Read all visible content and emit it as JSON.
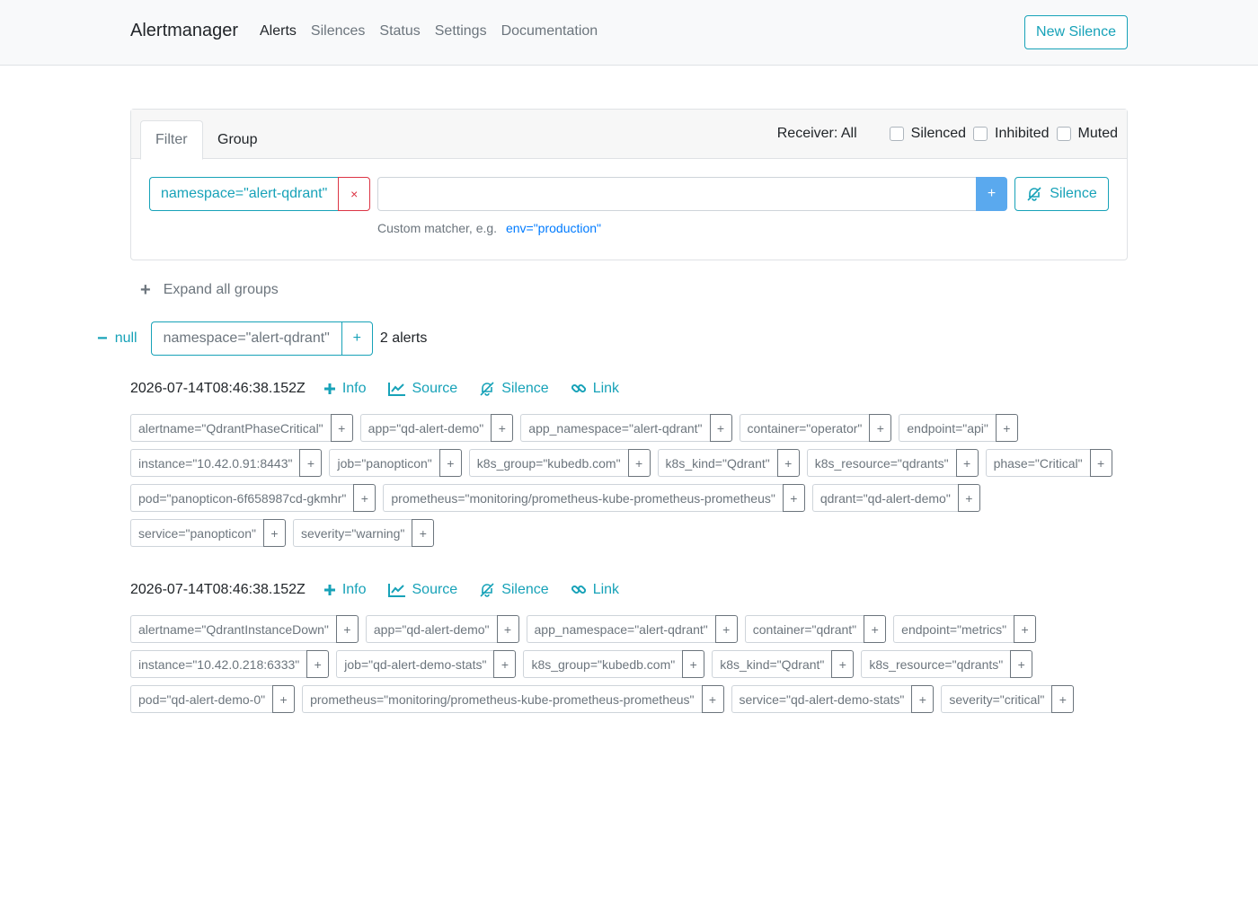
{
  "nav": {
    "brand": "Alertmanager",
    "links": [
      "Alerts",
      "Silences",
      "Status",
      "Settings",
      "Documentation"
    ],
    "new_silence": "New Silence"
  },
  "filter": {
    "tabs": [
      "Filter",
      "Group"
    ],
    "receiver": "Receiver: All",
    "checkboxes": [
      "Silenced",
      "Inhibited",
      "Muted"
    ],
    "matcher": "namespace=\"alert-qdrant\"",
    "remove": "×",
    "input_value": "",
    "add": "+",
    "silence": "Silence",
    "hint": "Custom matcher, e.g.",
    "hint_example": "env=\"production\""
  },
  "expand_all": "Expand all groups",
  "group": {
    "name": "null",
    "matcher": "namespace=\"alert-qdrant\"",
    "add": "+",
    "count": "2 alerts"
  },
  "actions": {
    "info": "Info",
    "source": "Source",
    "silence": "Silence",
    "link": "Link"
  },
  "alerts": [
    {
      "timestamp": "2026-07-14T08:46:38.152Z",
      "labels": [
        "alertname=\"QdrantPhaseCritical\"",
        "app=\"qd-alert-demo\"",
        "app_namespace=\"alert-qdrant\"",
        "container=\"operator\"",
        "endpoint=\"api\"",
        "instance=\"10.42.0.91:8443\"",
        "job=\"panopticon\"",
        "k8s_group=\"kubedb.com\"",
        "k8s_kind=\"Qdrant\"",
        "k8s_resource=\"qdrants\"",
        "phase=\"Critical\"",
        "pod=\"panopticon-6f658987cd-gkmhr\"",
        "prometheus=\"monitoring/prometheus-kube-prometheus-prometheus\"",
        "qdrant=\"qd-alert-demo\"",
        "service=\"panopticon\"",
        "severity=\"warning\""
      ]
    },
    {
      "timestamp": "2026-07-14T08:46:38.152Z",
      "labels": [
        "alertname=\"QdrantInstanceDown\"",
        "app=\"qd-alert-demo\"",
        "app_namespace=\"alert-qdrant\"",
        "container=\"qdrant\"",
        "endpoint=\"metrics\"",
        "instance=\"10.42.0.218:6333\"",
        "job=\"qd-alert-demo-stats\"",
        "k8s_group=\"kubedb.com\"",
        "k8s_kind=\"Qdrant\"",
        "k8s_resource=\"qdrants\"",
        "pod=\"qd-alert-demo-0\"",
        "prometheus=\"monitoring/prometheus-kube-prometheus-prometheus\"",
        "service=\"qd-alert-demo-stats\"",
        "severity=\"critical\""
      ]
    }
  ],
  "colors": {
    "accent": "#17a2b8",
    "danger": "#dc3545",
    "primary": "#5aa9ee"
  },
  "icons": {
    "info": "plus-icon",
    "source": "chart-line-icon",
    "silence": "bell-slash-icon",
    "link": "link-icon"
  }
}
